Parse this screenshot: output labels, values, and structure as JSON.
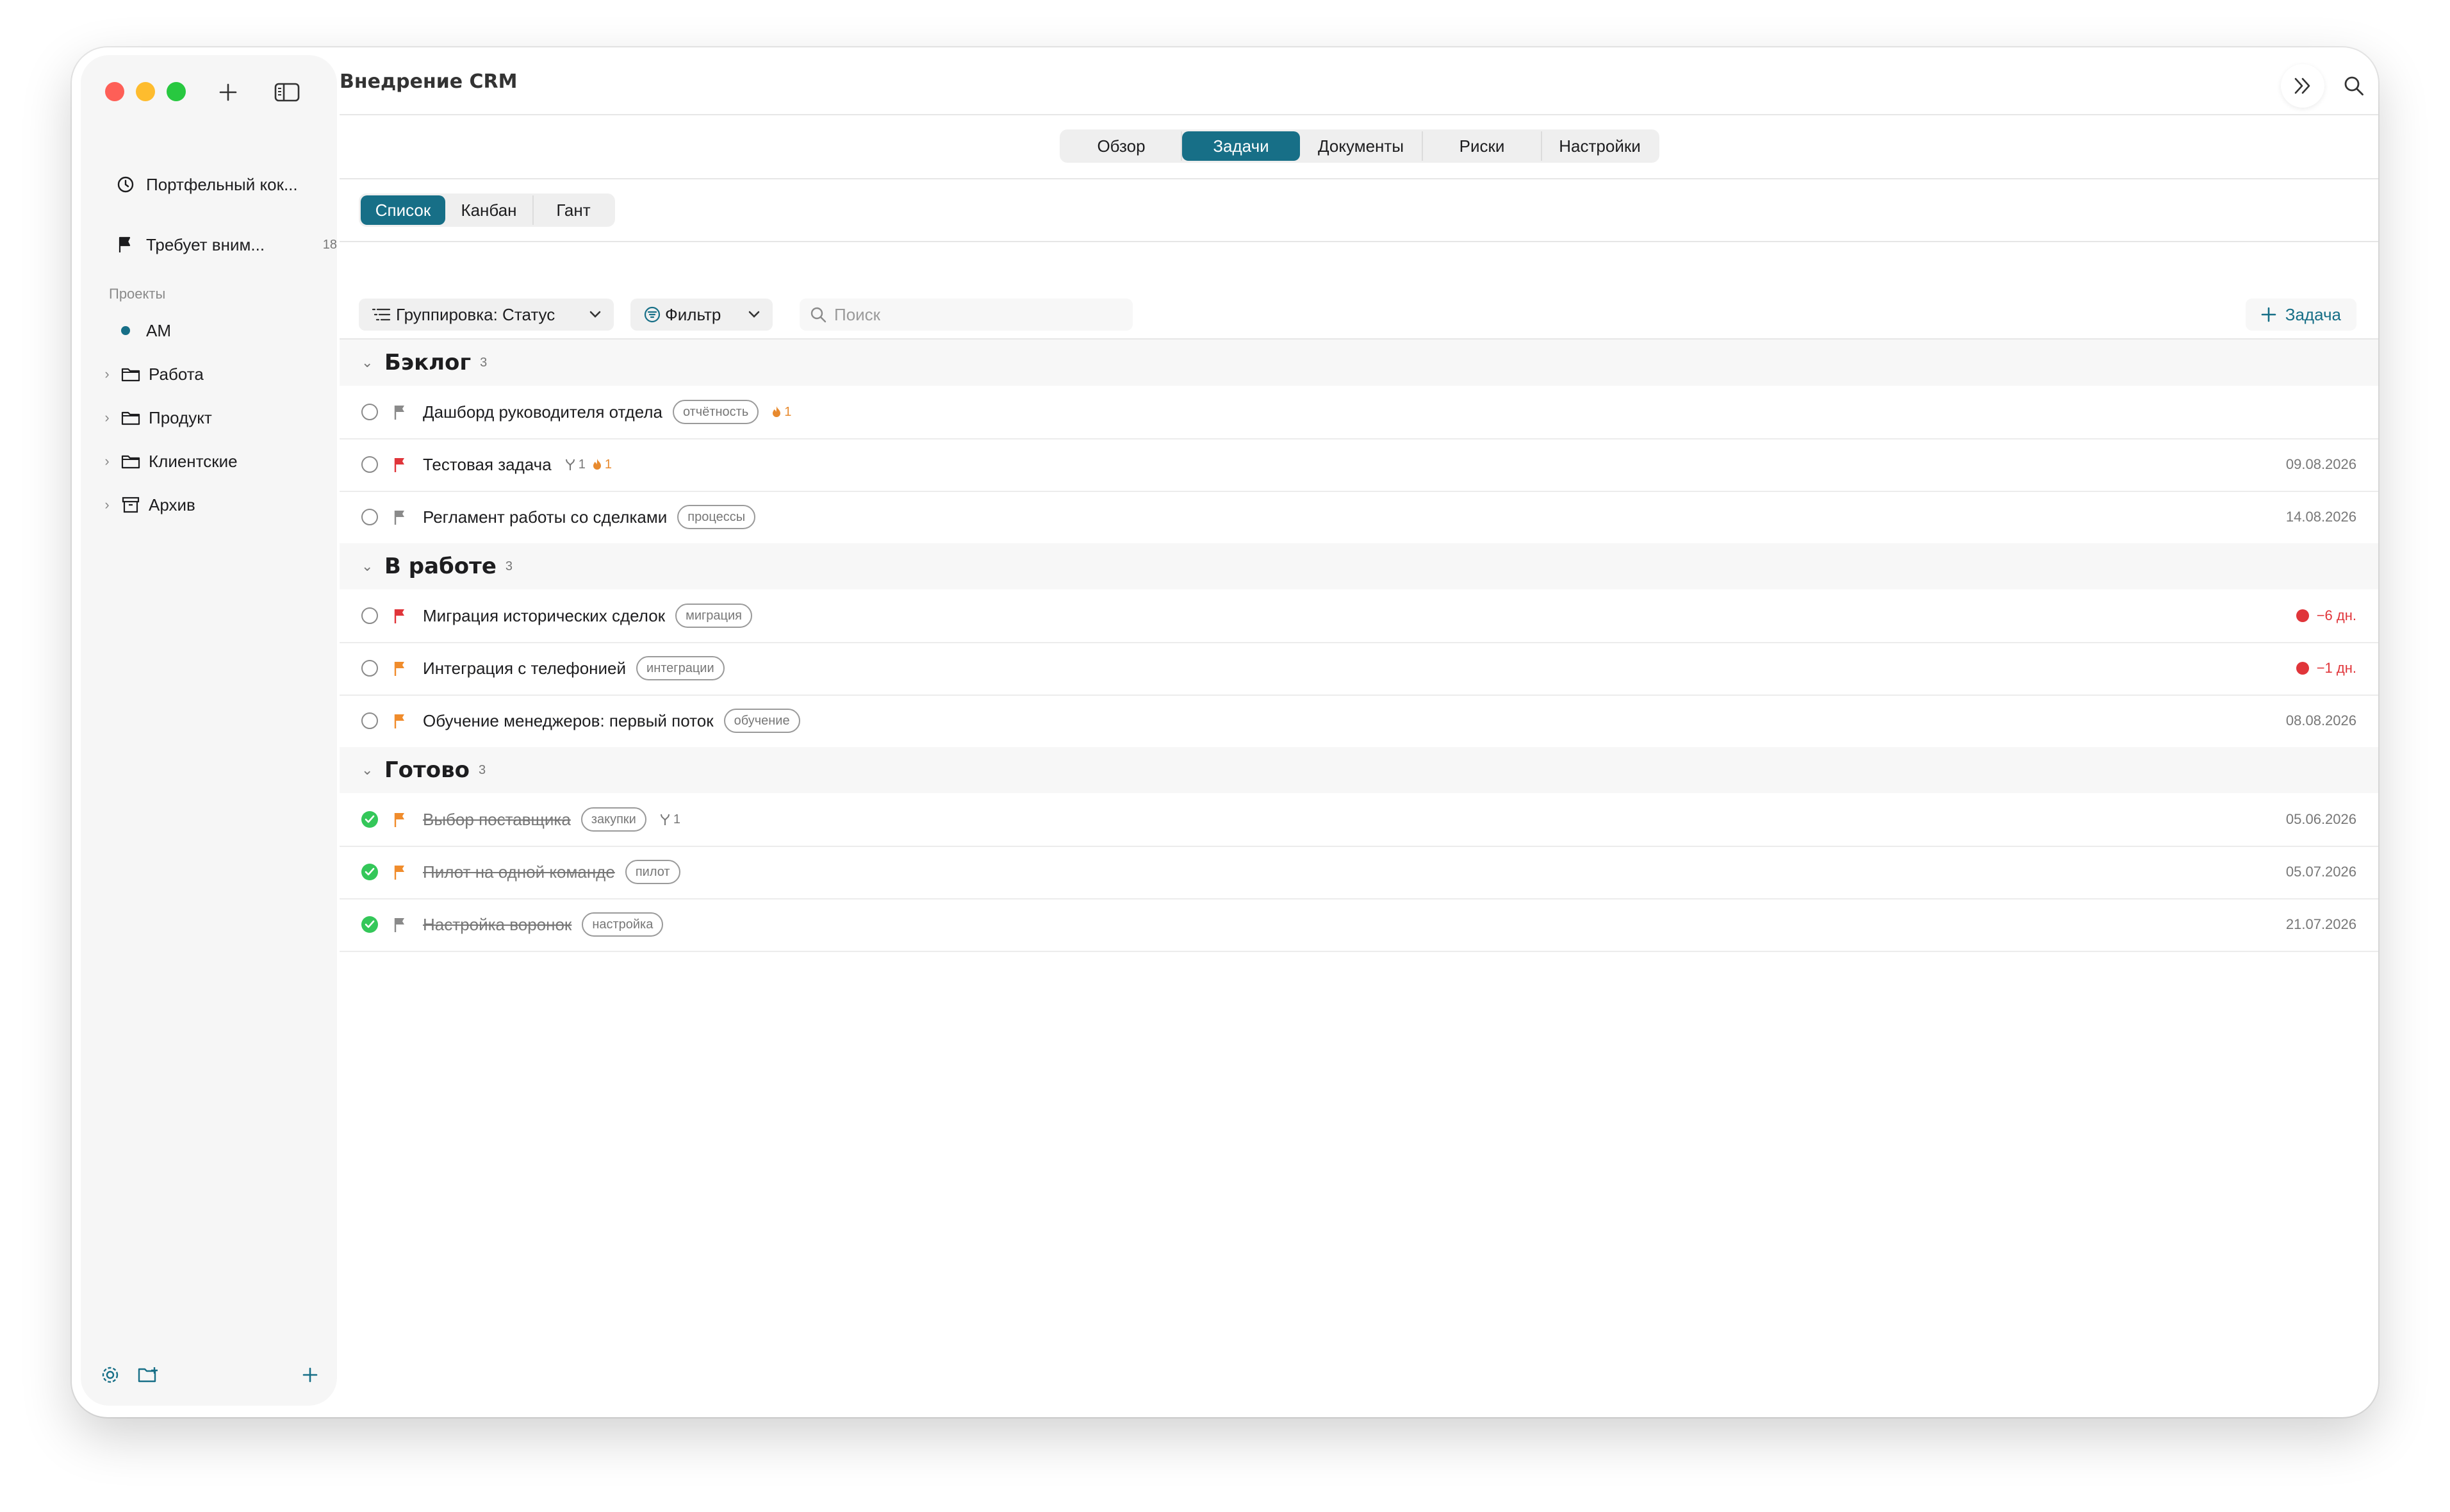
{
  "app": {
    "title": "Внедрение CRM"
  },
  "sidebar": {
    "items": [
      {
        "label": "Портфельный кок...",
        "icon": "clock-icon"
      },
      {
        "label": "Требует вним...",
        "icon": "flag-icon",
        "badge": "18"
      }
    ],
    "section_label": "Проекты",
    "projects": [
      {
        "label": "АМ",
        "icon": "dot-icon",
        "color": "#176f87"
      },
      {
        "label": "Работа",
        "icon": "folder-icon"
      },
      {
        "label": "Продукт",
        "icon": "folder-icon"
      },
      {
        "label": "Клиентские",
        "icon": "folder-icon"
      },
      {
        "label": "Архив",
        "icon": "archive-icon"
      }
    ]
  },
  "tabs": {
    "items": [
      "Обзор",
      "Задачи",
      "Документы",
      "Риски",
      "Настройки"
    ],
    "active": "Задачи"
  },
  "views": {
    "items": [
      "Список",
      "Канбан",
      "Гант"
    ],
    "active": "Список"
  },
  "toolbar": {
    "group_label": "Группировка: Статус",
    "filter_label": "Фильтр",
    "search_placeholder": "Поиск",
    "add_task_label": "Задача"
  },
  "colors": {
    "accent": "#176f87",
    "flag_grey": "#8a8a8a",
    "flag_red": "#e0353a",
    "flag_orange": "#f08c2c",
    "done_green": "#34c759"
  },
  "groups": [
    {
      "name": "Бэклог",
      "count": "3",
      "tasks": [
        {
          "name": "Дашборд руководителя отдела",
          "flag": "grey",
          "tag": "отчётность",
          "meta_fire": "1",
          "date": ""
        },
        {
          "name": "Тестовая задача",
          "flag": "red",
          "meta_sub": "1",
          "meta_fire": "1",
          "date": "09.08.2026"
        },
        {
          "name": "Регламент работы со сделками",
          "flag": "grey",
          "tag": "процессы",
          "date": "14.08.2026"
        }
      ]
    },
    {
      "name": "В работе",
      "count": "3",
      "tasks": [
        {
          "name": "Миграция исторических сделок",
          "flag": "red",
          "tag": "миграция",
          "overdue": "−6 дн."
        },
        {
          "name": "Интеграция с телефонией",
          "flag": "orange",
          "tag": "интеграции",
          "overdue": "−1 дн."
        },
        {
          "name": "Обучение менеджеров: первый поток",
          "flag": "orange",
          "tag": "обучение",
          "date": "08.08.2026"
        }
      ]
    },
    {
      "name": "Готово",
      "count": "3",
      "tasks": [
        {
          "name": "Выбор поставщика",
          "flag": "orange",
          "tag": "закупки",
          "meta_sub": "1",
          "date": "05.06.2026",
          "done": true
        },
        {
          "name": "Пилот на одной команде",
          "flag": "orange",
          "tag": "пилот",
          "date": "05.07.2026",
          "done": true
        },
        {
          "name": "Настройка воронок",
          "flag": "grey",
          "tag": "настройка",
          "date": "21.07.2026",
          "done": true
        }
      ]
    }
  ]
}
